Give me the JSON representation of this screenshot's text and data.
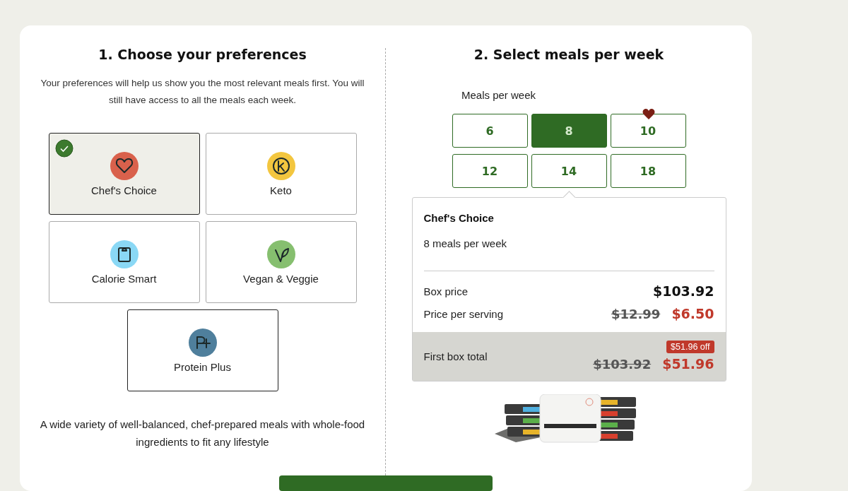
{
  "preferences": {
    "title": "1. Choose your preferences",
    "description": "Your preferences will help us show you the most relevant meals first. You will still have access to all the meals each week.",
    "options": [
      {
        "label": "Chef's Choice",
        "kind": "heart",
        "color": "#d9614c",
        "selected": true
      },
      {
        "label": "Keto",
        "kind": "keto",
        "color": "#f3c63f",
        "selected": false
      },
      {
        "label": "Calorie Smart",
        "kind": "scale",
        "color": "#8ad8f5",
        "selected": false
      },
      {
        "label": "Vegan & Veggie",
        "kind": "leaf",
        "color": "#86bf6f",
        "selected": false
      },
      {
        "label": "Protein Plus",
        "kind": "protein",
        "color": "#4f7f9c",
        "selected": false
      }
    ],
    "summary": "A wide variety of well-balanced, chef-prepared meals with whole-food ingredients to fit any lifestyle"
  },
  "meals": {
    "title": "2. Select meals per week",
    "label": "Meals per week",
    "options": [
      {
        "label": "6",
        "selected": false,
        "favorite": false
      },
      {
        "label": "8",
        "selected": true,
        "favorite": false
      },
      {
        "label": "10",
        "selected": false,
        "favorite": true
      },
      {
        "label": "12",
        "selected": false,
        "favorite": false
      },
      {
        "label": "14",
        "selected": false,
        "favorite": false
      },
      {
        "label": "18",
        "selected": false,
        "favorite": false
      }
    ],
    "summary": {
      "plan": "Chef's Choice",
      "meals": "8 meals per week",
      "rows": [
        {
          "label": "Box price",
          "price": "$103.92"
        },
        {
          "label": "Price per serving",
          "old_price": "$12.99",
          "price": "$6.50"
        }
      ],
      "total": {
        "label": "First box total",
        "badge": "$51.96 off",
        "old_price": "$103.92",
        "price": "$51.96"
      }
    }
  }
}
